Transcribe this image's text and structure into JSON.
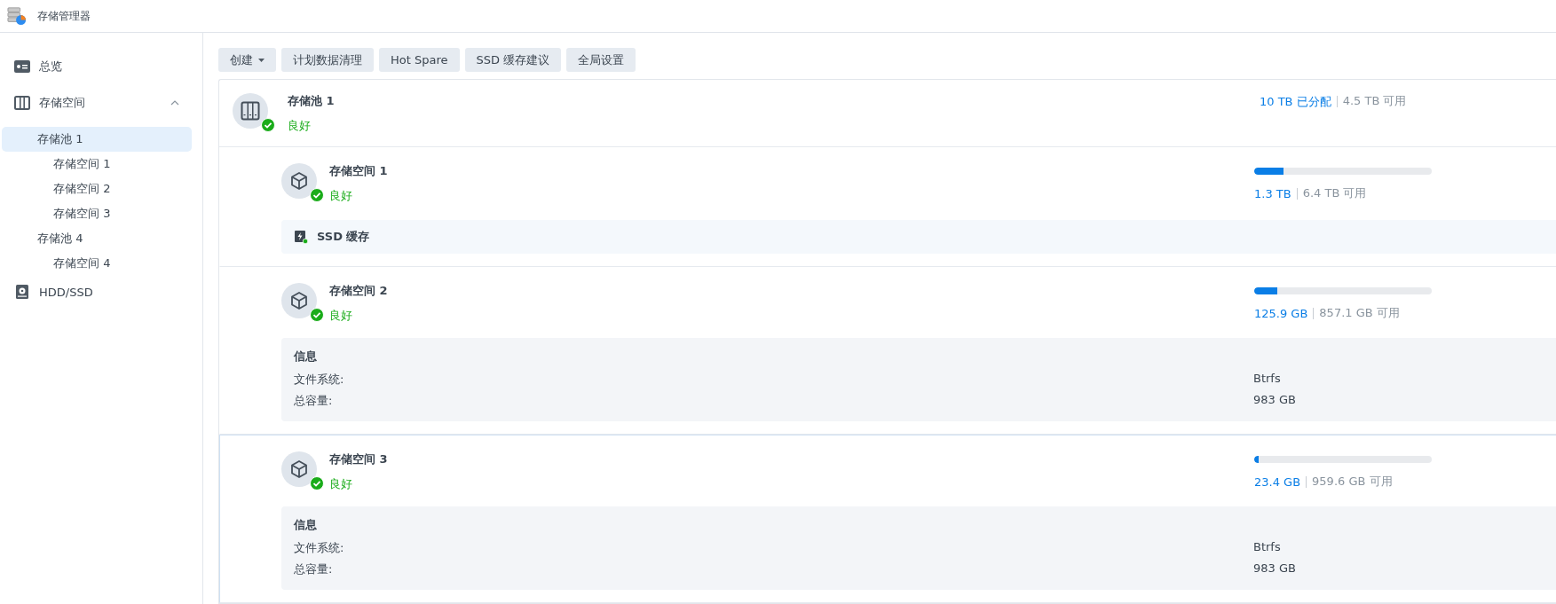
{
  "window": {
    "title": "存储管理器"
  },
  "sidebar": {
    "items": [
      {
        "label": "总览",
        "kind": "overview",
        "selected": false
      },
      {
        "label": "存储空间",
        "kind": "storage",
        "selected": false,
        "expanded": true,
        "children": [
          {
            "label": "存储池 1",
            "selected": true,
            "children": [
              {
                "label": "存储空间 1",
                "selected": false
              },
              {
                "label": "存储空间 2",
                "selected": false
              },
              {
                "label": "存储空间 3",
                "selected": false
              }
            ]
          },
          {
            "label": "存储池 4",
            "selected": false,
            "children": [
              {
                "label": "存储空间 4",
                "selected": false
              }
            ]
          }
        ]
      },
      {
        "label": "HDD/SSD",
        "kind": "disk",
        "selected": false
      }
    ]
  },
  "toolbar": [
    {
      "label": "创建",
      "dropdown": true
    },
    {
      "label": "计划数据清理",
      "dropdown": false
    },
    {
      "label": "Hot Spare",
      "dropdown": false
    },
    {
      "label": "SSD 缓存建议",
      "dropdown": false
    },
    {
      "label": "全局设置",
      "dropdown": false
    }
  ],
  "pool": {
    "name": "存储池 1",
    "status": "良好",
    "allocated": "10 TB 已分配",
    "free": "4.5 TB 可用"
  },
  "volumes": [
    {
      "name": "存储空间 1",
      "status": "良好",
      "used": "1.3 TB",
      "free": "6.4 TB 可用",
      "level": 0.165,
      "selected": false,
      "ssd_cache": {
        "label": "SSD 缓存"
      }
    },
    {
      "name": "存储空间 2",
      "status": "良好",
      "used": "125.9 GB",
      "free": "857.1 GB 可用",
      "level": 0.128,
      "selected": false,
      "info": {
        "title": "信息",
        "rows": [
          {
            "label": "文件系统:",
            "value": "Btrfs"
          },
          {
            "label": "总容量:",
            "value": "983 GB"
          }
        ]
      }
    },
    {
      "name": "存储空间 3",
      "status": "良好",
      "used": "23.4 GB",
      "free": "959.6 GB 可用",
      "level": 0.024,
      "selected": true,
      "info": {
        "title": "信息",
        "rows": [
          {
            "label": "文件系统:",
            "value": "Btrfs"
          },
          {
            "label": "总容量:",
            "value": "983 GB"
          }
        ]
      }
    }
  ]
}
